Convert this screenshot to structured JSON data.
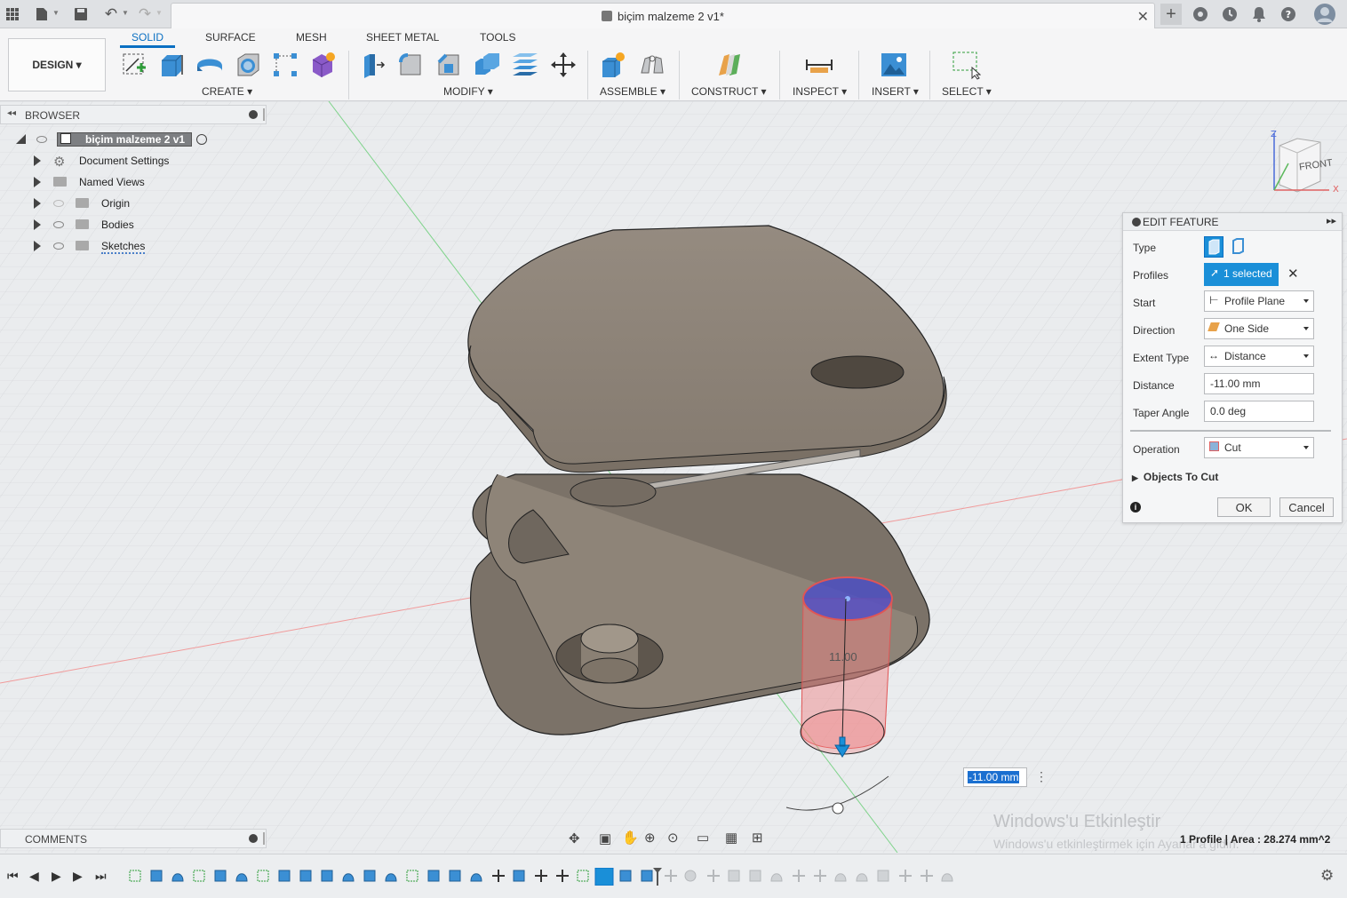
{
  "window": {
    "document_title": "biçim malzeme 2 v1*"
  },
  "toolbar": {
    "workspace_button": "DESIGN ▾",
    "tabs": [
      "SOLID",
      "SURFACE",
      "MESH",
      "SHEET METAL",
      "TOOLS"
    ],
    "active_tab": "SOLID",
    "groups": [
      "CREATE ▾",
      "MODIFY ▾",
      "ASSEMBLE ▾",
      "CONSTRUCT ▾",
      "INSPECT ▾",
      "INSERT ▾",
      "SELECT ▾"
    ]
  },
  "browser": {
    "title": "BROWSER",
    "root_label": "biçim malzeme 2 v1",
    "items": [
      {
        "label": "Document Settings",
        "icon": "gear-icon"
      },
      {
        "label": "Named Views",
        "icon": "folder-icon"
      },
      {
        "label": "Origin",
        "icon": "folder-icon"
      },
      {
        "label": "Bodies",
        "icon": "folder-icon"
      },
      {
        "label": "Sketches",
        "icon": "folder-icon"
      }
    ]
  },
  "edit_feature": {
    "title": "EDIT FEATURE",
    "type_label": "Type",
    "profiles_label": "Profiles",
    "profiles_value": "1 selected",
    "start_label": "Start",
    "start_value": "Profile Plane",
    "direction_label": "Direction",
    "direction_value": "One Side",
    "extent_label": "Extent Type",
    "extent_value": "Distance",
    "distance_label": "Distance",
    "distance_value": "-11.00 mm",
    "taper_label": "Taper Angle",
    "taper_value": "0.0 deg",
    "operation_label": "Operation",
    "operation_value": "Cut",
    "objects_to_cut_label": "Objects To Cut",
    "ok_label": "OK",
    "cancel_label": "Cancel"
  },
  "viewport": {
    "viewcube_label": "FRONT",
    "dimension_label": "11.00",
    "distance_input": "-11.00 mm",
    "status_text": "1 Profile | Area : 28.274 mm^2",
    "watermark_title": "Windows'u Etkinleştir",
    "watermark_sub": "Windows'u etkinleştirmek için Ayarlar'a gidin."
  },
  "comments": {
    "title": "COMMENTS"
  },
  "colors": {
    "accent": "#0a6fc2",
    "selected_field": "#1a8fd8",
    "body": "#8d8377",
    "cut_red": "#e85b5b"
  }
}
